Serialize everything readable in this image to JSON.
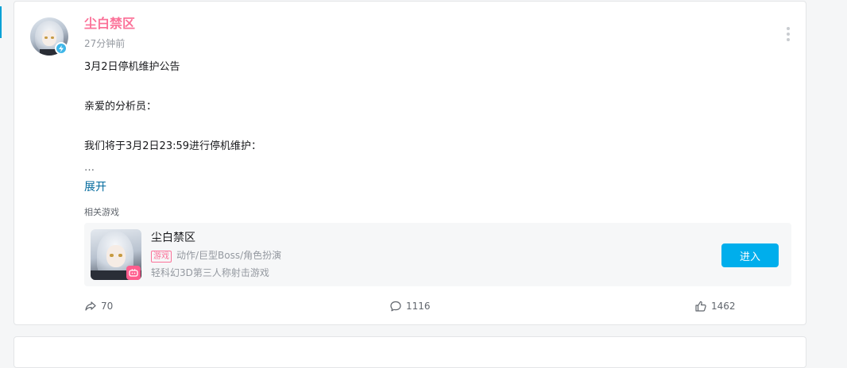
{
  "post": {
    "author": "尘白禁区",
    "time": "27分钟前",
    "content": {
      "line1": "3月2日停机维护公告",
      "line2": "亲爱的分析员：",
      "line3": "我们将于3月2日23:59进行停机维护：",
      "ellipsis": "…"
    },
    "expand_label": "展开",
    "related_label": "相关游戏",
    "game": {
      "title": "尘白禁区",
      "tag": "游戏",
      "genres": "动作/巨型Boss/角色扮演",
      "description": "轻科幻3D第三人称射击游戏",
      "enter_label": "进入"
    },
    "stats": {
      "forward": "70",
      "comment": "1116",
      "like": "1462"
    }
  },
  "colors": {
    "author": "#fb7299",
    "accent": "#00aeec",
    "link": "#00699d",
    "muted": "#9499a0"
  },
  "icons": [
    "lightning-badge-icon",
    "more-vertical-icon",
    "game-controller-icon",
    "forward-icon",
    "comment-icon",
    "like-icon"
  ]
}
